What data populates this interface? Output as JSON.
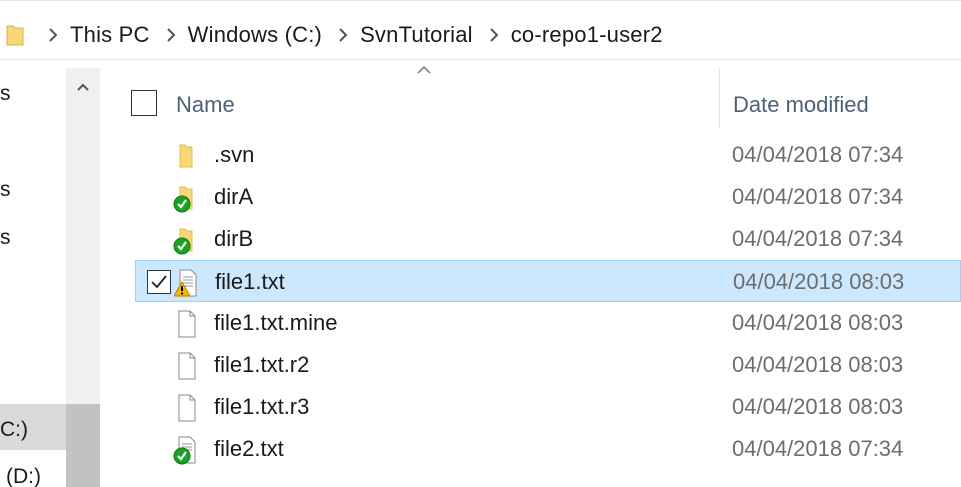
{
  "address_bar": {
    "crumbs": [
      "This PC",
      "Windows (C:)",
      "SvnTutorial",
      "co-repo1-user2"
    ]
  },
  "nav_pane": {
    "items": [
      "s",
      "s",
      "s",
      "C:)",
      "(D:)"
    ]
  },
  "file_list": {
    "columns": {
      "name": "Name",
      "date_modified": "Date modified"
    },
    "rows": [
      {
        "name": ".svn",
        "date": "04/04/2018 07:34",
        "icon": "folder-icon",
        "overlay": "none",
        "selected": false
      },
      {
        "name": "dirA",
        "date": "04/04/2018 07:34",
        "icon": "folder-icon",
        "overlay": "svn-normal-overlay-icon",
        "selected": false
      },
      {
        "name": "dirB",
        "date": "04/04/2018 07:34",
        "icon": "folder-icon",
        "overlay": "svn-normal-overlay-icon",
        "selected": false
      },
      {
        "name": "file1.txt",
        "date": "04/04/2018 08:03",
        "icon": "text-file-icon",
        "overlay": "svn-conflict-overlay-icon",
        "selected": true
      },
      {
        "name": "file1.txt.mine",
        "date": "04/04/2018 08:03",
        "icon": "blank-file-icon",
        "overlay": "none",
        "selected": false
      },
      {
        "name": "file1.txt.r2",
        "date": "04/04/2018 08:03",
        "icon": "blank-file-icon",
        "overlay": "none",
        "selected": false
      },
      {
        "name": "file1.txt.r3",
        "date": "04/04/2018 08:03",
        "icon": "blank-file-icon",
        "overlay": "none",
        "selected": false
      },
      {
        "name": "file2.txt",
        "date": "04/04/2018 07:34",
        "icon": "text-file-icon",
        "overlay": "svn-normal-overlay-icon",
        "selected": false
      }
    ]
  },
  "colors": {
    "selection_bg": "#cce8ff",
    "selection_border": "#99d1ff",
    "header_text": "#4c607a",
    "date_text": "#6d6d6d",
    "folder": "#f8d775",
    "svn_ok": "#1aa224",
    "svn_conflict": "#f5b800"
  }
}
